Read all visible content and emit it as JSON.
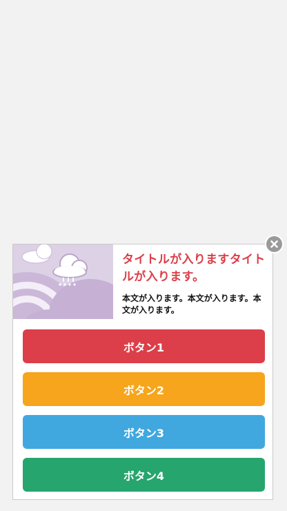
{
  "popup": {
    "title": "タイトルが入りますタイトルが入ります。",
    "body": "本文が入ります。本文が入ります。本文が入ります。",
    "close_icon": "close-icon",
    "image_icon": "rain-cloud-rainbow-illustration"
  },
  "buttons": [
    {
      "label": "ボタン1",
      "color": "#dc3f49"
    },
    {
      "label": "ボタン2",
      "color": "#f6a51c"
    },
    {
      "label": "ボタン3",
      "color": "#41a8df"
    },
    {
      "label": "ボタン4",
      "color": "#27a56e"
    }
  ],
  "colors": {
    "background": "#f2f2f2",
    "title": "#dc3d48",
    "image_bg": "#dccfe5"
  }
}
